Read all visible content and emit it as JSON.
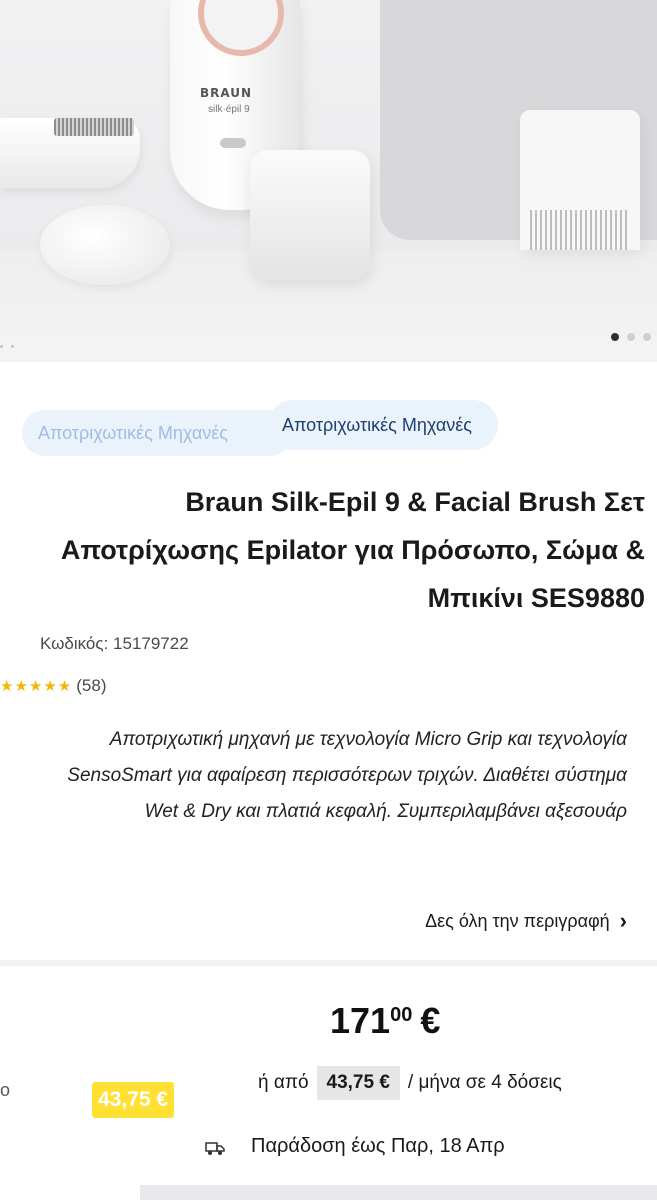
{
  "gallery": {
    "brand_text": "BRAUN",
    "model_text": "silk·épil 9",
    "slide_count": 3,
    "active_slide": 1
  },
  "breadcrumb": {
    "ghost_label": "Αποτριχωτικές Μηχανές",
    "category_label": "Αποτριχωτικές Μηχανές"
  },
  "product": {
    "title": "Braun Silk-Epil 9 & Facial Brush Σετ Αποτρίχωσης Epilator για Πρόσωπο, Σώμα & Μπικίνι SES9880",
    "code_text": "Κωδικός: 15179722",
    "rating_value": 4.5,
    "review_count": "(58)",
    "description": "Αποτριχωτική μηχανή με τεχνολογία Micro Grip και τεχνολογία SensoSmart για αφαίρεση περισσότερων τριχών. Διαθέτει σύστημα Wet & Dry και πλατιά κεφαλή. Συμπεριλαμβάνει αξεσουάρ",
    "see_more": "Δες όλη την περιγραφή"
  },
  "pricing": {
    "price_main": "171",
    "price_cents": "00",
    "currency": "€",
    "installment_prefix": "ή από",
    "installment_amount": "43,75 €",
    "installment_suffix": "/ μήνα σε 4 δόσεις",
    "promo_badge": "43,75 €",
    "edge_text": "ο"
  },
  "delivery": {
    "text": "Παράδοση έως Παρ, 18 Απρ"
  },
  "colors": {
    "accent_blue": "#1f3f6e",
    "chip_bg": "#eaf2fb",
    "star": "#f2b705",
    "promo_bg": "#ffe033"
  }
}
